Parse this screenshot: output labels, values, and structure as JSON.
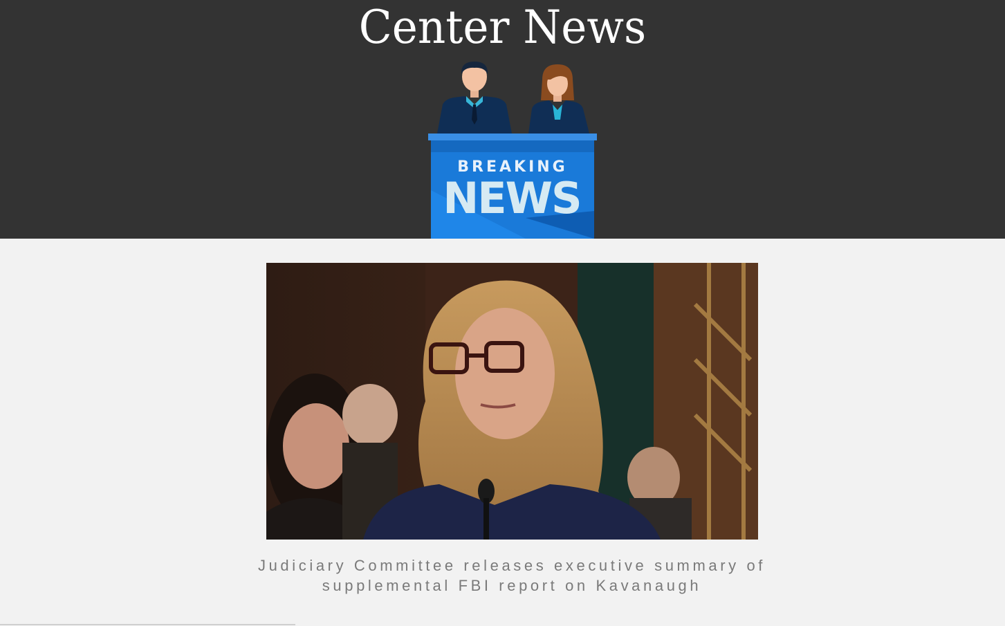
{
  "site": {
    "title": "Center News"
  },
  "logo": {
    "line1": "BREAKING",
    "line2": "NEWS",
    "icon": "breaking-news-anchors-icon"
  },
  "article": {
    "headline": "Judiciary Committee releases executive summary of supplemental FBI report on Kavanaugh",
    "image_icon": "photo-hearing"
  },
  "colors": {
    "header_bg": "#333333",
    "page_bg": "#f2f2f2",
    "podium_blue": "#1a7ad9",
    "headline_text": "#7a7a7a"
  }
}
